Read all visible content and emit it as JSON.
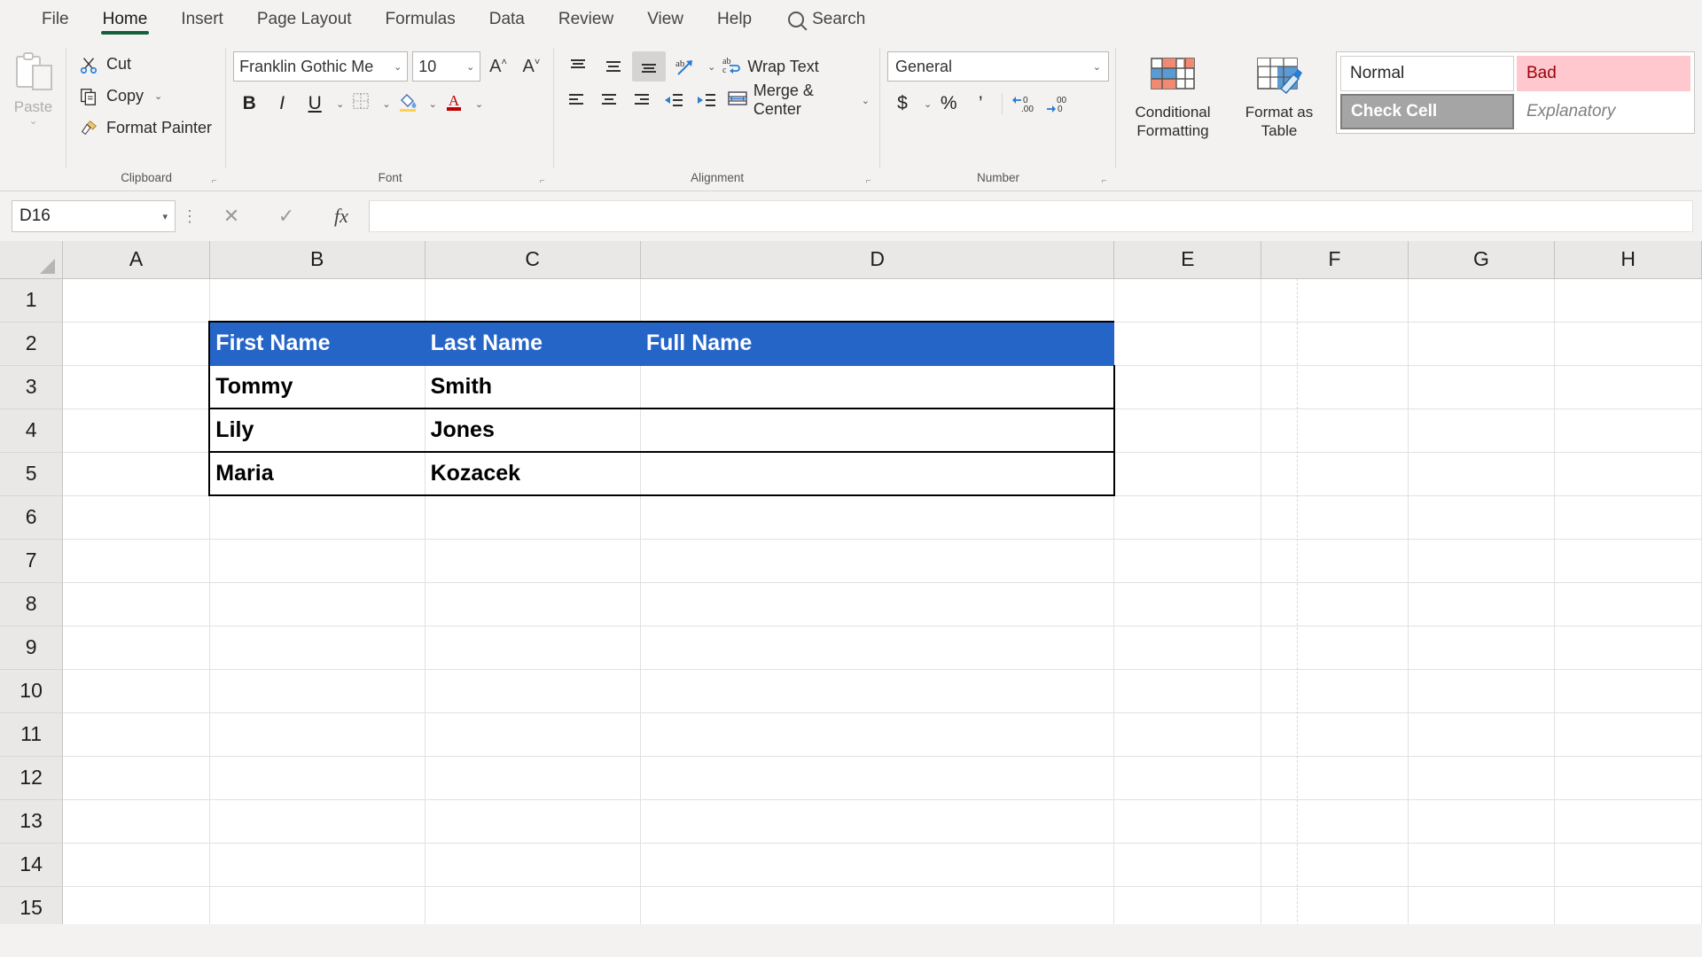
{
  "app": {
    "active_tab": "Home"
  },
  "tabs": [
    {
      "label": "File"
    },
    {
      "label": "Home"
    },
    {
      "label": "Insert"
    },
    {
      "label": "Page Layout"
    },
    {
      "label": "Formulas"
    },
    {
      "label": "Data"
    },
    {
      "label": "Review"
    },
    {
      "label": "View"
    },
    {
      "label": "Help"
    }
  ],
  "search": {
    "label": "Search",
    "icon": "search-icon"
  },
  "ribbon": {
    "clipboard": {
      "group_label": "Clipboard",
      "paste_label": "Paste",
      "cut_label": "Cut",
      "copy_label": "Copy",
      "format_painter_label": "Format Painter"
    },
    "font": {
      "group_label": "Font",
      "font_name": "Franklin Gothic Me",
      "font_size": "10",
      "bold": "B",
      "italic": "I",
      "underline": "U",
      "grow_font": "A",
      "shrink_font": "A"
    },
    "alignment": {
      "group_label": "Alignment",
      "wrap_text_label": "Wrap Text",
      "merge_center_label": "Merge & Center"
    },
    "number": {
      "group_label": "Number",
      "format": "General",
      "currency": "$",
      "percent": "%",
      "comma": "’"
    },
    "styles": {
      "conditional_formatting_label": "Conditional Formatting",
      "format_as_table_label": "Format as Table",
      "cell_styles": [
        {
          "name": "Normal"
        },
        {
          "name": "Bad"
        },
        {
          "name": "Check Cell"
        },
        {
          "name": "Explanatory"
        }
      ]
    }
  },
  "formula_bar": {
    "name_box": "D16",
    "cancel_icon": "cancel-icon",
    "enter_icon": "confirm-icon",
    "function_icon": "insert-function-icon",
    "formula_value": ""
  },
  "grid": {
    "columns": [
      "A",
      "B",
      "C",
      "D",
      "E",
      "F",
      "G",
      "H"
    ],
    "rows": [
      "1",
      "2",
      "3",
      "4",
      "5",
      "6",
      "7",
      "8",
      "9",
      "10",
      "11",
      "12",
      "13",
      "14",
      "15"
    ],
    "table": {
      "header": [
        "First Name",
        "Last Name",
        "Full Name"
      ],
      "records": [
        {
          "first": "Tommy",
          "last": "Smith",
          "full": ""
        },
        {
          "first": "Lily",
          "last": "Jones",
          "full": ""
        },
        {
          "first": "Maria",
          "last": "Kozacek",
          "full": ""
        }
      ]
    },
    "colors": {
      "header_fill": "#2565c7",
      "header_text": "#ffffff",
      "header_row_index": 2,
      "data_start_row": 3
    }
  }
}
